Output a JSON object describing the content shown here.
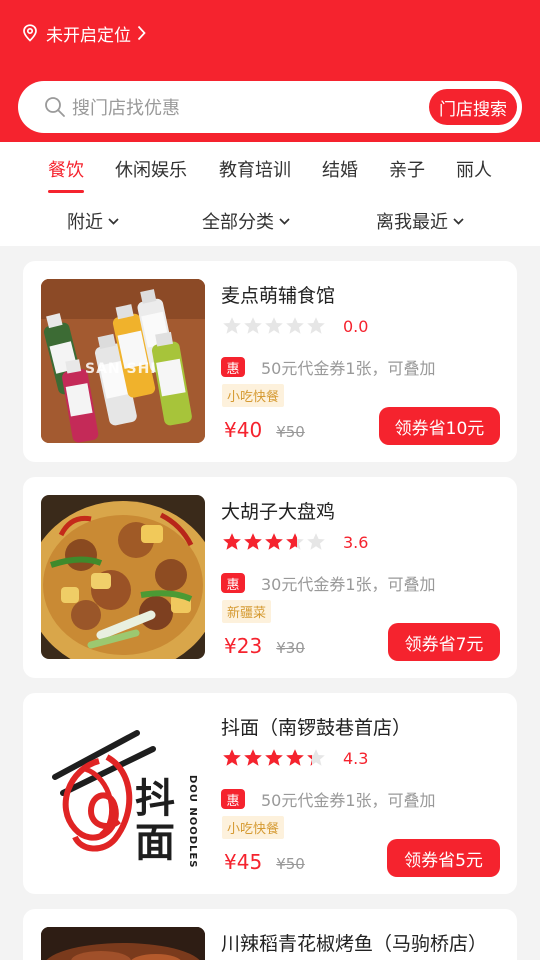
{
  "header": {
    "location_text": "未开启定位",
    "search_placeholder": "搜门店找优惠",
    "search_button": "门店搜索"
  },
  "tabs": [
    "餐饮",
    "休闲娱乐",
    "教育培训",
    "结婚",
    "亲子",
    "丽人"
  ],
  "active_tab": "餐饮",
  "filters": [
    "附近",
    "全部分类",
    "离我最近"
  ],
  "shops": [
    {
      "name": "麦点萌辅食馆",
      "rating": 0.0,
      "rating_text": "0.0",
      "promo_badge": "惠",
      "promo_text": "50元代金券1张，可叠加",
      "tag": "小吃快餐",
      "price": "¥40",
      "original_price": "¥50",
      "coupon_button": "领券省10元",
      "image_text": "SAN SHI"
    },
    {
      "name": "大胡子大盘鸡",
      "rating": 3.6,
      "rating_text": "3.6",
      "promo_badge": "惠",
      "promo_text": "30元代金券1张，可叠加",
      "tag": "新疆菜",
      "price": "¥23",
      "original_price": "¥30",
      "coupon_button": "领券省7元"
    },
    {
      "name": "抖面（南锣鼓巷首店）",
      "rating": 4.3,
      "rating_text": "4.3",
      "promo_badge": "惠",
      "promo_text": "50元代金券1张，可叠加",
      "tag": "小吃快餐",
      "price": "¥45",
      "original_price": "¥50",
      "coupon_button": "领券省5元",
      "logo_text": "抖面",
      "logo_subtext": "DOU NOODLES"
    },
    {
      "name": "川辣稻青花椒烤鱼（马驹桥店）"
    }
  ],
  "colors": {
    "brand_red": "#f5232e",
    "star_gray": "#e6e6e6",
    "tag_bg": "#fdf1dc",
    "tag_text": "#d59a32",
    "page_bg": "#f3f3f3"
  },
  "icons": [
    "location-pin-icon",
    "chevron-right-icon",
    "search-icon",
    "chevron-down-icon",
    "star-icon"
  ]
}
